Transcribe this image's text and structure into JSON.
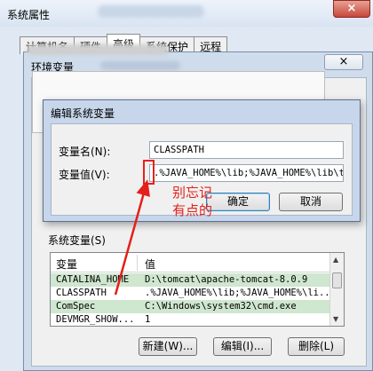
{
  "outer_window": {
    "title": "系统属性",
    "close_glyph": "×",
    "tabs": [
      {
        "label": "计算机名"
      },
      {
        "label": "硬件"
      },
      {
        "label": "高级"
      },
      {
        "label": "系统保护"
      },
      {
        "label": "远程"
      }
    ]
  },
  "env_dialog": {
    "title": "环境变量",
    "close_glyph": "×",
    "system_group_label": "系统变量(S)",
    "columns": [
      "变量",
      "值"
    ],
    "system_rows": [
      {
        "name": "CATALINA_HOME",
        "value": "D:\\tomcat\\apache-tomcat-8.0.9"
      },
      {
        "name": "CLASSPATH",
        "value": ".%JAVA_HOME%\\lib;%JAVA_HOME%\\li..."
      },
      {
        "name": "ComSpec",
        "value": "C:\\Windows\\system32\\cmd.exe"
      },
      {
        "name": "DEVMGR_SHOW...",
        "value": "1"
      }
    ],
    "buttons": {
      "new": "新建(W)...",
      "edit": "编辑(I)...",
      "delete": "删除(L)"
    }
  },
  "edit_dialog": {
    "title": "编辑系统变量",
    "name_label": "变量名(N):",
    "name_value": "CLASSPATH",
    "value_label": "变量值(V):",
    "value_value": ".%JAVA_HOME%\\lib;%JAVA_HOME%\\lib\\to",
    "ok_label": "确定",
    "cancel_label": "取消"
  },
  "annotation": {
    "line1": "别忘记",
    "line2": "有点的",
    "color": "#e3201b"
  }
}
